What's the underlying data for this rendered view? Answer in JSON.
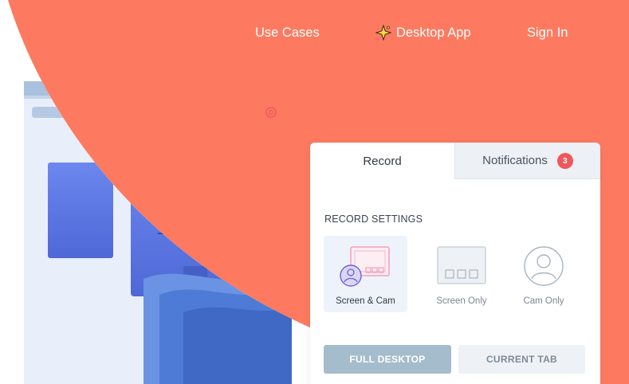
{
  "nav": {
    "links": [
      "Use Cases",
      "Desktop App",
      "Sign In"
    ],
    "desktop_icon": "sparkle-icon"
  },
  "colors": {
    "background": "#fd7a60",
    "accent_red": "#f0575a",
    "card_blue": "#5f7ee8",
    "button_primary": "#a4bccb"
  },
  "recorder": {
    "tabs": {
      "record": "Record",
      "notifications": "Notifications",
      "notification_count": "3"
    },
    "settings_title": "RECORD SETTINGS",
    "modes": [
      {
        "label": "Screen & Cam",
        "icon": "screen-cam-icon",
        "selected": true
      },
      {
        "label": "Screen Only",
        "icon": "screen-icon",
        "selected": false
      },
      {
        "label": "Cam Only",
        "icon": "cam-icon",
        "selected": false
      }
    ],
    "buttons": {
      "full_desktop": "FULL DESKTOP",
      "current_tab": "CURRENT TAB"
    }
  }
}
